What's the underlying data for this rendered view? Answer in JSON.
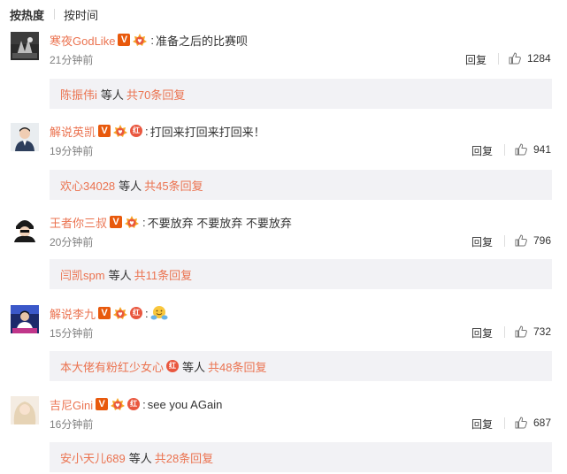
{
  "sort_bar": {
    "by_hot": "按热度",
    "by_time": "按时间"
  },
  "labels": {
    "reply": "回复",
    "others": "等人"
  },
  "colors": {
    "username": "#eb7350",
    "vip_badge": "#e8590c",
    "reply_box_bg": "#f2f2f5"
  },
  "comments": [
    {
      "user": "寒夜GodLike",
      "badges": [
        "vip-badge-icon",
        "fan-medal-icon"
      ],
      "text": "准备之后的比赛呗",
      "time": "21分钟前",
      "likes": "1284",
      "reply_user": "陈振伟i",
      "reply_count": "共70条回复"
    },
    {
      "user": "解说英凯",
      "badges": [
        "vip-badge-icon",
        "fan-medal-icon",
        "red-badge-icon"
      ],
      "text": "打回来打回来打回来！",
      "time": "19分钟前",
      "likes": "941",
      "reply_user": "欢心34028",
      "reply_count": "共45条回复"
    },
    {
      "user": "王者你三叔",
      "badges": [
        "vip-badge-icon",
        "fan-medal-icon"
      ],
      "text": "不要放弃 不要放弃 不要放弃",
      "time": "20分钟前",
      "likes": "796",
      "reply_user": "闫凯spm",
      "reply_count": "共11条回复"
    },
    {
      "user": "解说李九",
      "badges": [
        "vip-badge-icon",
        "fan-medal-icon",
        "red-badge-icon"
      ],
      "text": "",
      "emoji": "hug-emoji-icon",
      "time": "15分钟前",
      "likes": "732",
      "reply_user": "本大佬有粉红少女心",
      "reply_count": "共48条回复"
    },
    {
      "user": "吉尼Gini",
      "badges": [
        "vip-badge-icon",
        "fan-medal-icon",
        "red-badge-icon"
      ],
      "text": "see you AGain",
      "time": "16分钟前",
      "likes": "687",
      "reply_user": "安小天儿689",
      "reply_count": "共28条回复"
    }
  ]
}
